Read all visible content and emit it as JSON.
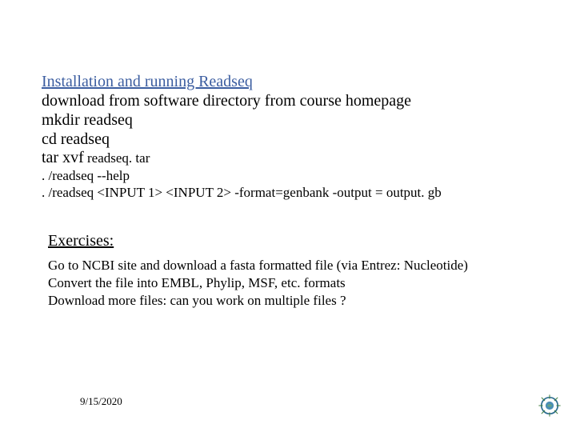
{
  "heading": "Installation and running Readseq",
  "install": {
    "l1": "download from software directory from course homepage",
    "l2": "mkdir readseq",
    "l3": "cd readseq",
    "l4a": "tar xvf",
    "l4b": " readseq. tar",
    "l5": ". /readseq --help",
    "l6": ". /readseq <INPUT 1> <INPUT 2> -format=genbank -output = output. gb"
  },
  "exercises": {
    "title": "Exercises:",
    "e1": "Go to NCBI site and download a fasta formatted file (via Entrez: Nucleotide)",
    "e2": "Convert the file into EMBL, Phylip, MSF, etc. formats",
    "e3": "Download more files: can you work on multiple files ?"
  },
  "footer": {
    "date": "9/15/2020"
  }
}
